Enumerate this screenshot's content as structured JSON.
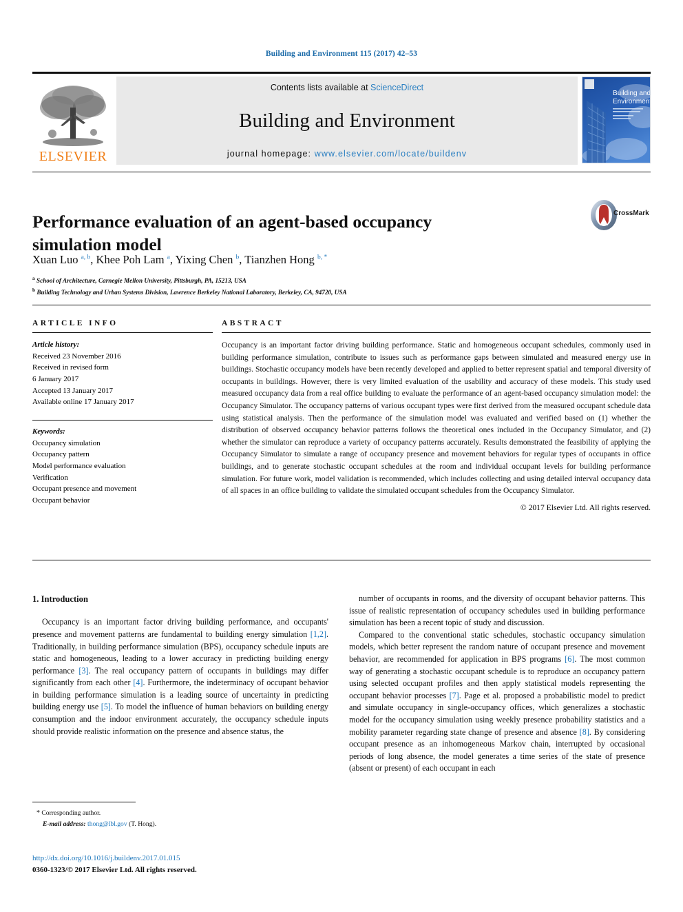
{
  "running_head": "Building and Environment 115 (2017) 42–53",
  "masthead": {
    "publisher": "ELSEVIER",
    "contents_prefix": "Contents lists available at ",
    "contents_link": "ScienceDirect",
    "journal_name": "Building and Environment",
    "homepage_prefix": "journal homepage: ",
    "homepage_url": "www.elsevier.com/locate/buildenv",
    "cover_title_line1": "Building and",
    "cover_title_line2": "Environment"
  },
  "article": {
    "title": "Performance evaluation of an agent-based occupancy simulation model",
    "crossmark_label": "CrossMark",
    "authors_html": "Xuan Luo <sup>a, b</sup>, Khee Poh Lam <sup>a</sup>, Yixing Chen <sup>b</sup>, Tianzhen Hong <sup>b, *</sup>",
    "affiliations": [
      {
        "marker": "a",
        "text": "School of Architecture, Carnegie Mellon University, Pittsburgh, PA, 15213, USA"
      },
      {
        "marker": "b",
        "text": "Building Technology and Urban Systems Division, Lawrence Berkeley National Laboratory, Berkeley, CA, 94720, USA"
      }
    ]
  },
  "info": {
    "heading": "ARTICLE INFO",
    "history_label": "Article history:",
    "history": [
      "Received 23 November 2016",
      "Received in revised form",
      "6 January 2017",
      "Accepted 13 January 2017",
      "Available online 17 January 2017"
    ],
    "keywords_label": "Keywords:",
    "keywords": [
      "Occupancy simulation",
      "Occupancy pattern",
      "Model performance evaluation",
      "Verification",
      "Occupant presence and movement",
      "Occupant behavior"
    ]
  },
  "abstract": {
    "heading": "ABSTRACT",
    "text": "Occupancy is an important factor driving building performance. Static and homogeneous occupant schedules, commonly used in building performance simulation, contribute to issues such as performance gaps between simulated and measured energy use in buildings. Stochastic occupancy models have been recently developed and applied to better represent spatial and temporal diversity of occupants in buildings. However, there is very limited evaluation of the usability and accuracy of these models. This study used measured occupancy data from a real office building to evaluate the performance of an agent-based occupancy simulation model: the Occupancy Simulator. The occupancy patterns of various occupant types were first derived from the measured occupant schedule data using statistical analysis. Then the performance of the simulation model was evaluated and verified based on (1) whether the distribution of observed occupancy behavior patterns follows the theoretical ones included in the Occupancy Simulator, and (2) whether the simulator can reproduce a variety of occupancy patterns accurately. Results demonstrated the feasibility of applying the Occupancy Simulator to simulate a range of occupancy presence and movement behaviors for regular types of occupants in office buildings, and to generate stochastic occupant schedules at the room and individual occupant levels for building performance simulation. For future work, model validation is recommended, which includes collecting and using detailed interval occupancy data of all spaces in an office building to validate the simulated occupant schedules from the Occupancy Simulator.",
    "copyright": "© 2017 Elsevier Ltd. All rights reserved."
  },
  "introduction": {
    "section_title": "1. Introduction",
    "left_paragraphs": [
      "Occupancy is an important factor driving building performance, and occupants' presence and movement patterns are fundamental to building energy simulation [1,2]. Traditionally, in building performance simulation (BPS), occupancy schedule inputs are static and homogeneous, leading to a lower accuracy in predicting building energy performance [3]. The real occupancy pattern of occupants in buildings may differ significantly from each other [4]. Furthermore, the indeterminacy of occupant behavior in building performance simulation is a leading source of uncertainty in predicting building energy use [5]. To model the influence of human behaviors on building energy consumption and the indoor environment accurately, the occupancy schedule inputs should provide realistic information on the presence and absence status, the"
    ],
    "right_paragraphs": [
      "number of occupants in rooms, and the diversity of occupant behavior patterns. This issue of realistic representation of occupancy schedules used in building performance simulation has been a recent topic of study and discussion.",
      "Compared to the conventional static schedules, stochastic occupancy simulation models, which better represent the random nature of occupant presence and movement behavior, are recommended for application in BPS programs [6]. The most common way of generating a stochastic occupant schedule is to reproduce an occupancy pattern using selected occupant profiles and then apply statistical models representing the occupant behavior processes [7]. Page et al. proposed a probabilistic model to predict and simulate occupancy in single-occupancy offices, which generalizes a stochastic model for the occupancy simulation using weekly presence probability statistics and a mobility parameter regarding state change of presence and absence [8]. By considering occupant presence as an inhomogeneous Markov chain, interrupted by occasional periods of long absence, the model generates a time series of the state of presence (absent or present) of each occupant in each"
    ],
    "citations": [
      "1,2",
      "3",
      "4",
      "5",
      "6",
      "7",
      "8"
    ]
  },
  "footer": {
    "corresponding_marker": "*",
    "corresponding_label": "Corresponding author.",
    "email_label": "E-mail address:",
    "email": "thong@lbl.gov",
    "email_suffix": "(T. Hong).",
    "doi_url": "http://dx.doi.org/10.1016/j.buildenv.2017.01.015",
    "issn_line": "0360-1323/© 2017 Elsevier Ltd. All rights reserved."
  },
  "colors": {
    "link_blue": "#1a75bb",
    "header_blue": "#1a6aa8",
    "elsevier_orange": "#f07f18",
    "band_gray": "#e9e9e9"
  }
}
